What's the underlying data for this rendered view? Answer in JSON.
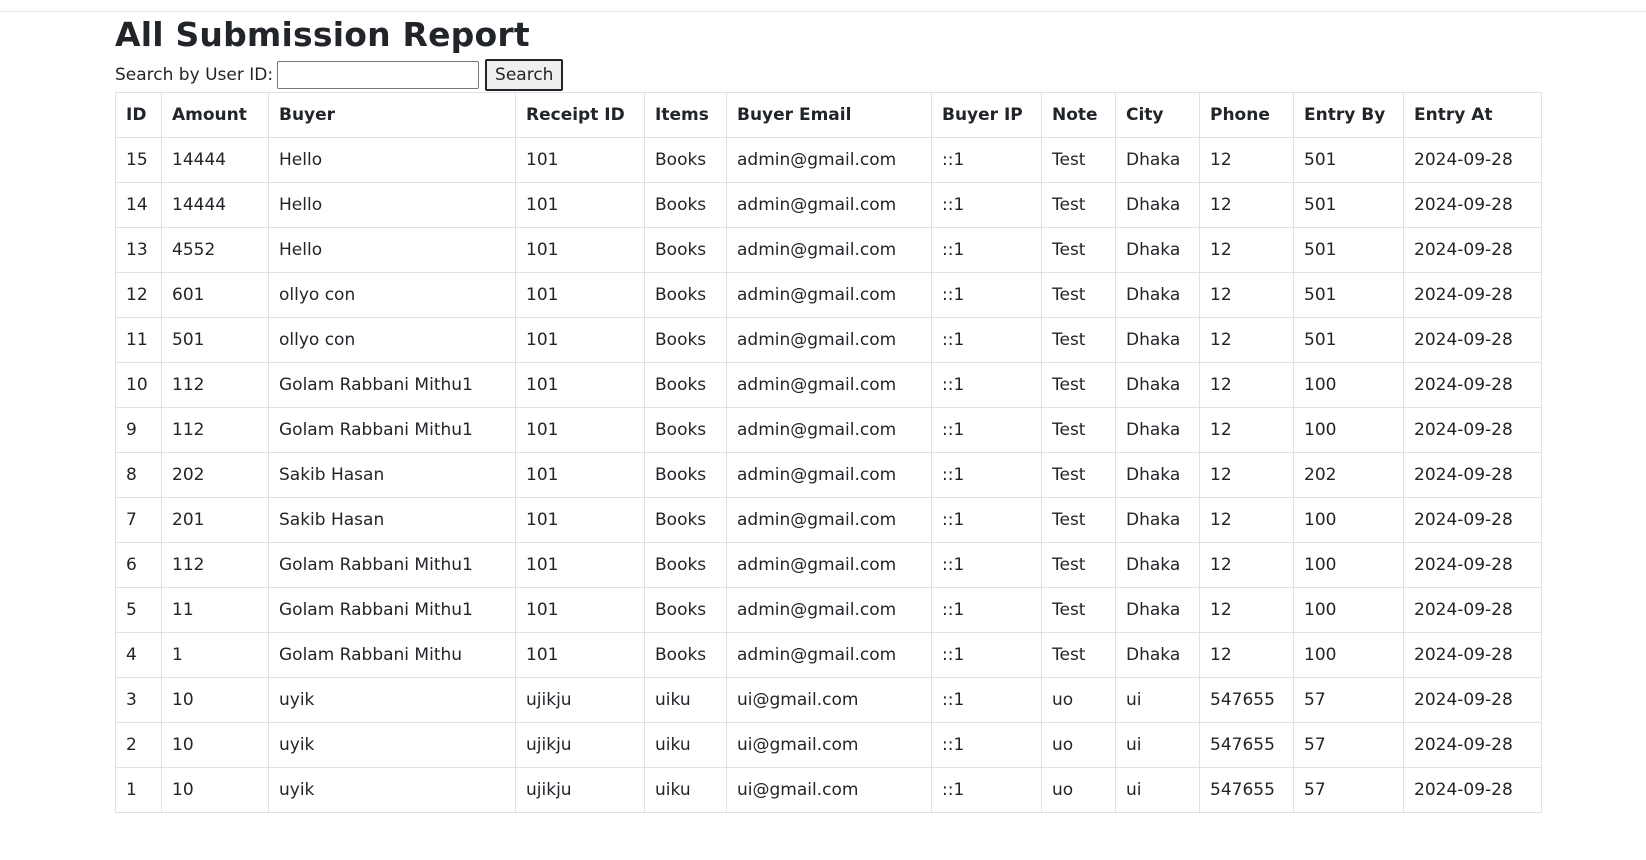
{
  "page": {
    "title": "All Submission Report"
  },
  "search": {
    "label": "Search by User ID:",
    "value": "",
    "placeholder": "",
    "button_label": "Search"
  },
  "table": {
    "columns": [
      "ID",
      "Amount",
      "Buyer",
      "Receipt ID",
      "Items",
      "Buyer Email",
      "Buyer IP",
      "Note",
      "City",
      "Phone",
      "Entry By",
      "Entry At"
    ],
    "rows": [
      [
        "15",
        "14444",
        "Hello",
        "101",
        "Books",
        "admin@gmail.com",
        "::1",
        "Test",
        "Dhaka",
        "12",
        "501",
        "2024-09-28"
      ],
      [
        "14",
        "14444",
        "Hello",
        "101",
        "Books",
        "admin@gmail.com",
        "::1",
        "Test",
        "Dhaka",
        "12",
        "501",
        "2024-09-28"
      ],
      [
        "13",
        "4552",
        "Hello",
        "101",
        "Books",
        "admin@gmail.com",
        "::1",
        "Test",
        "Dhaka",
        "12",
        "501",
        "2024-09-28"
      ],
      [
        "12",
        "601",
        "ollyo con",
        "101",
        "Books",
        "admin@gmail.com",
        "::1",
        "Test",
        "Dhaka",
        "12",
        "501",
        "2024-09-28"
      ],
      [
        "11",
        "501",
        "ollyo con",
        "101",
        "Books",
        "admin@gmail.com",
        "::1",
        "Test",
        "Dhaka",
        "12",
        "501",
        "2024-09-28"
      ],
      [
        "10",
        "112",
        "Golam Rabbani Mithu1",
        "101",
        "Books",
        "admin@gmail.com",
        "::1",
        "Test",
        "Dhaka",
        "12",
        "100",
        "2024-09-28"
      ],
      [
        "9",
        "112",
        "Golam Rabbani Mithu1",
        "101",
        "Books",
        "admin@gmail.com",
        "::1",
        "Test",
        "Dhaka",
        "12",
        "100",
        "2024-09-28"
      ],
      [
        "8",
        "202",
        "Sakib Hasan",
        "101",
        "Books",
        "admin@gmail.com",
        "::1",
        "Test",
        "Dhaka",
        "12",
        "202",
        "2024-09-28"
      ],
      [
        "7",
        "201",
        "Sakib Hasan",
        "101",
        "Books",
        "admin@gmail.com",
        "::1",
        "Test",
        "Dhaka",
        "12",
        "100",
        "2024-09-28"
      ],
      [
        "6",
        "112",
        "Golam Rabbani Mithu1",
        "101",
        "Books",
        "admin@gmail.com",
        "::1",
        "Test",
        "Dhaka",
        "12",
        "100",
        "2024-09-28"
      ],
      [
        "5",
        "11",
        "Golam Rabbani Mithu1",
        "101",
        "Books",
        "admin@gmail.com",
        "::1",
        "Test",
        "Dhaka",
        "12",
        "100",
        "2024-09-28"
      ],
      [
        "4",
        "1",
        "Golam Rabbani Mithu",
        "101",
        "Books",
        "admin@gmail.com",
        "::1",
        "Test",
        "Dhaka",
        "12",
        "100",
        "2024-09-28"
      ],
      [
        "3",
        "10",
        "uyik",
        "ujikju",
        "uiku",
        "ui@gmail.com",
        "::1",
        "uo",
        "ui",
        "547655",
        "57",
        "2024-09-28"
      ],
      [
        "2",
        "10",
        "uyik",
        "ujikju",
        "uiku",
        "ui@gmail.com",
        "::1",
        "uo",
        "ui",
        "547655",
        "57",
        "2024-09-28"
      ],
      [
        "1",
        "10",
        "uyik",
        "ujikju",
        "uiku",
        "ui@gmail.com",
        "::1",
        "uo",
        "ui",
        "547655",
        "57",
        "2024-09-28"
      ]
    ]
  }
}
